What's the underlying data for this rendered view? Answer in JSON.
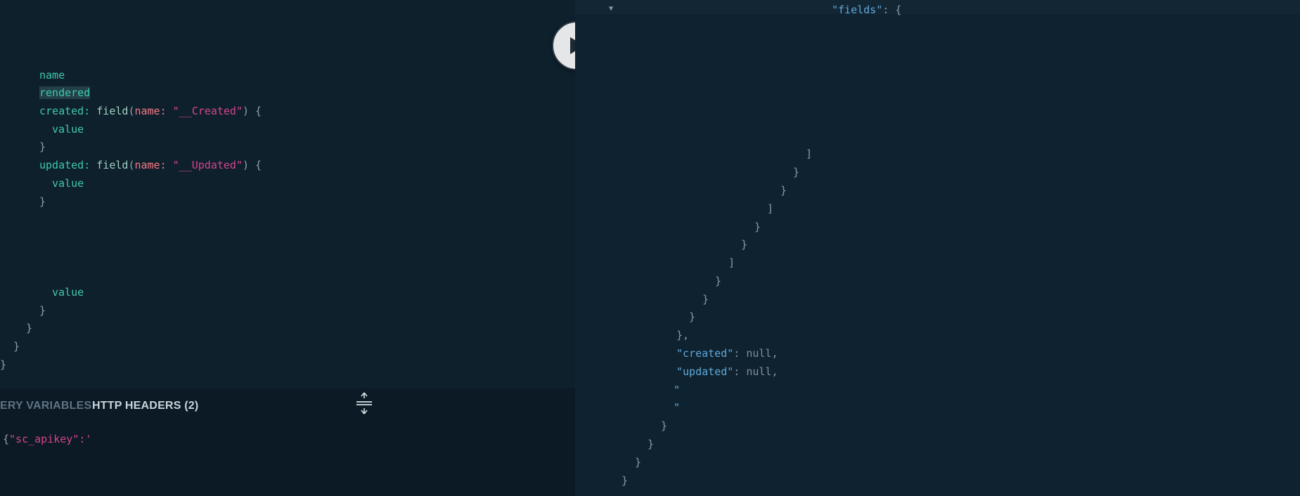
{
  "query_editor": {
    "lines": {
      "name": "name",
      "rendered": "rendered",
      "created_alias": "created:",
      "field_fn": "field",
      "arg_name": "name:",
      "created_str": "\"__Created\"",
      "open_brace": ") {",
      "open_paren": "(",
      "value": "value",
      "close_brace": "}",
      "updated_alias": "updated:",
      "updated_str": "\"__Updated\""
    }
  },
  "run_button": {
    "label": "Execute query",
    "icon": "play-icon"
  },
  "variables_panel": {
    "tabs": {
      "query_variables": "ERY VARIABLES",
      "http_headers": "HTTP HEADERS (2)"
    },
    "headers_text": {
      "open": "{",
      "key": "\"sc_apikey\"",
      "colon": ":'"
    },
    "resize_icon": "resize-vertical-icon"
  },
  "result_viewer": {
    "fold_icon": "triangle-down-icon",
    "fields_key": "\"fields\"",
    "fields_rest": ": {",
    "bracket_close": "]",
    "brace_close": "}",
    "brace_close_comma": "},",
    "created_key": "\"created\"",
    "updated_key": "\"updated\"",
    "colon": ": ",
    "null_value": "null",
    "comma": ",",
    "quote": "\""
  },
  "colors": {
    "editor_bg": "#0f202d",
    "result_bg": "#0f222f",
    "field": "#3ec9a7",
    "argument": "#f47a86",
    "string": "#d6448c",
    "json_key": "#5fa8dd"
  }
}
